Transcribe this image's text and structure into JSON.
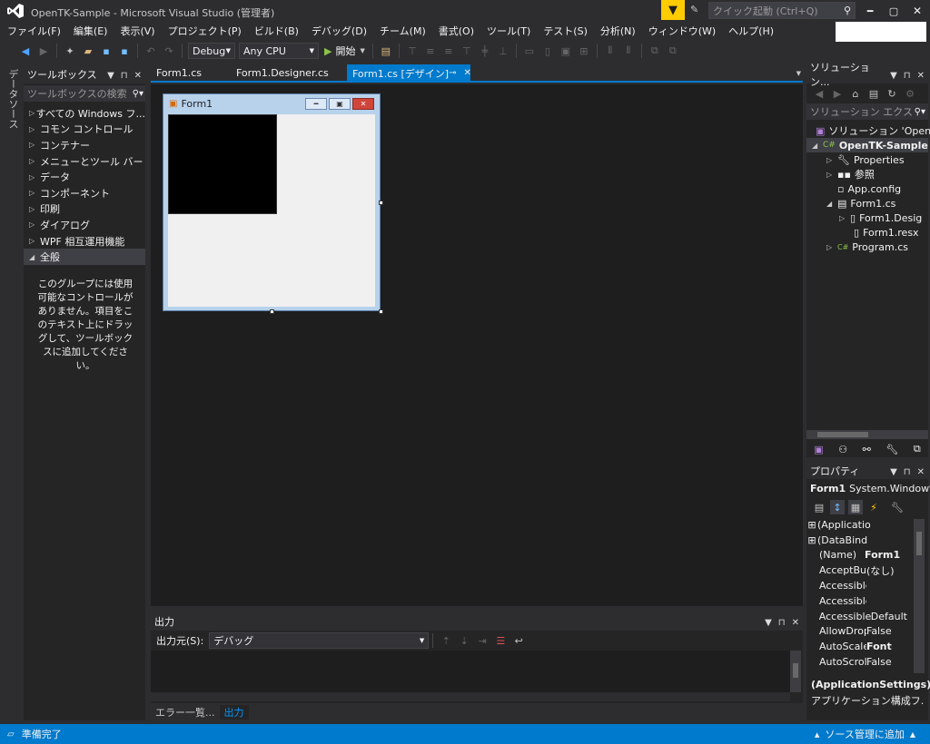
{
  "window": {
    "title": "OpenTK-Sample - Microsoft Visual Studio (管理者)",
    "quick_launch_placeholder": "クイック起動 (Ctrl+Q)"
  },
  "menu": [
    "ファイル(F)",
    "編集(E)",
    "表示(V)",
    "プロジェクト(P)",
    "ビルド(B)",
    "デバッグ(D)",
    "チーム(M)",
    "書式(O)",
    "ツール(T)",
    "テスト(S)",
    "分析(N)",
    "ウィンドウ(W)",
    "ヘルプ(H)"
  ],
  "toolbar": {
    "config": "Debug",
    "platform": "Any CPU",
    "start_label": "開始"
  },
  "left_strip": {
    "label": "データソース"
  },
  "toolbox": {
    "title": "ツールボックス",
    "search_placeholder": "ツールボックスの検索",
    "groups": [
      "すべての Windows フ...",
      "コモン コントロール",
      "コンテナー",
      "メニューとツール バー",
      "データ",
      "コンポーネント",
      "印刷",
      "ダイアログ",
      "WPF 相互運用機能"
    ],
    "active_group": "全般",
    "empty_message": "このグループには使用可能なコントロールがありません。項目をこのテキスト上にドラッグして、ツールボックスに追加してください。"
  },
  "tabs": {
    "t1": "Form1.cs",
    "t2": "Form1.Designer.cs",
    "t3": "Form1.cs [デザイン]",
    "t3_pin": "⊸",
    "t3_close": "✕"
  },
  "designer": {
    "form_title": "Form1"
  },
  "output": {
    "title": "出力",
    "source_label": "出力元(S):",
    "source_value": "デバッグ",
    "bottom_tabs": [
      "エラー一覧...",
      "出力"
    ]
  },
  "solution_explorer": {
    "title": "ソリューション...",
    "search_placeholder": "ソリューション エクス",
    "solution": "ソリューション 'OpenT",
    "project": "OpenTK-Sample",
    "items": {
      "properties": "Properties",
      "references": "参照",
      "appconfig": "App.config",
      "form1cs": "Form1.cs",
      "form1designer": "Form1.Desig",
      "form1resx": "Form1.resx",
      "program": "Program.cs"
    }
  },
  "properties": {
    "title": "プロパティ",
    "object_name": "Form1",
    "object_type": "System.Window",
    "rows": [
      {
        "name": "(Applicatio",
        "value": "",
        "expand": "⊞"
      },
      {
        "name": "(DataBind",
        "value": "",
        "expand": "⊞"
      },
      {
        "name": "(Name)",
        "value": "Form1",
        "bold": true
      },
      {
        "name": "AcceptBut",
        "value": "(なし)"
      },
      {
        "name": "Accessible",
        "value": ""
      },
      {
        "name": "Accessible",
        "value": ""
      },
      {
        "name": "Accessible",
        "value": "Default"
      },
      {
        "name": "AllowDrop",
        "value": "False"
      },
      {
        "name": "AutoScale",
        "value": "Font",
        "bold": true
      },
      {
        "name": "AutoScroll",
        "value": "False"
      }
    ],
    "desc_title": "(ApplicationSettings)",
    "desc_text": "アプリケーション構成フ..."
  },
  "statusbar": {
    "left": "準備完了",
    "right": "ソース管理に追加",
    "right_arrow": "▴"
  },
  "colors": {
    "accent": "#007acc",
    "vs_purple": "#68217a",
    "notify_yellow": "#ffcc00"
  }
}
